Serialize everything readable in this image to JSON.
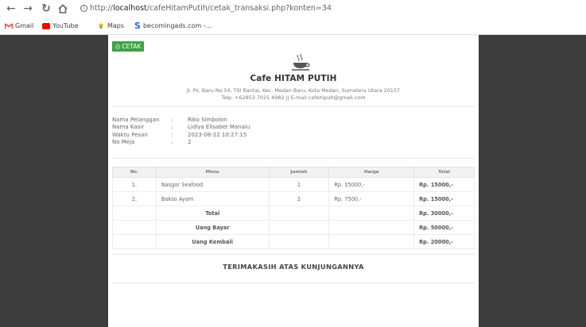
{
  "browser": {
    "url_prefix": "http://",
    "url_host": "localhost",
    "url_path": "/cafeHitamPutih/cetak_transaksi.php?konten=34",
    "bookmarks": [
      {
        "label": "Gmail",
        "icon": "gmail-icon",
        "color": "#ea4335"
      },
      {
        "label": "YouTube",
        "icon": "youtube-icon",
        "color": "#ff0000"
      },
      {
        "label": "Maps",
        "icon": "maps-icon",
        "color": "#fbbc04"
      },
      {
        "label": "becomingads.com -...",
        "icon": "becomingads-icon",
        "color": "#2962ff"
      }
    ]
  },
  "receipt": {
    "print_label": "CETAK",
    "cafe_name": "Cafe HITAM PUTIH",
    "address": "Jl. Ps. Baru No.54, Titi Rantai, Kec. Medan Baru, Kota Medan, Sumatera Utara 20157",
    "contact": "Telp. +62853 7021 4982 || E-mail cafehiputi@gmail.com",
    "info": [
      {
        "label": "Nama Pelanggan",
        "value": "Riko Simbolon"
      },
      {
        "label": "Nama Kasir",
        "value": "Lidiya Elisabet Manalu"
      },
      {
        "label": "Waktu Pesan",
        "value": "2023-08-22 10:27:15"
      },
      {
        "label": "No Meja",
        "value": "2"
      }
    ],
    "colon": ":",
    "table_headers": [
      "No.",
      "Menu",
      "Jumlah",
      "Harga",
      "Total"
    ],
    "items": [
      {
        "no": "1.",
        "menu": "Nasgor Seafood",
        "qty": "1",
        "price": "Rp. 15000,-",
        "total": "Rp. 15000,-"
      },
      {
        "no": "2.",
        "menu": "Bakso Ayam",
        "qty": "2",
        "price": "Rp. 7500,-",
        "total": "Rp. 15000,-"
      }
    ],
    "summary": [
      {
        "label": "Total",
        "value": "Rp. 30000,-"
      },
      {
        "label": "Uang Bayar",
        "value": "Rp. 50000,-"
      },
      {
        "label": "Uang Kembali",
        "value": "Rp. 20000,-"
      }
    ],
    "thanks": "TERIMAKASIH ATAS KUNJUNGANNYA"
  },
  "colors": {
    "print_button": "#3ea344",
    "side_background": "#3c3c3c"
  }
}
